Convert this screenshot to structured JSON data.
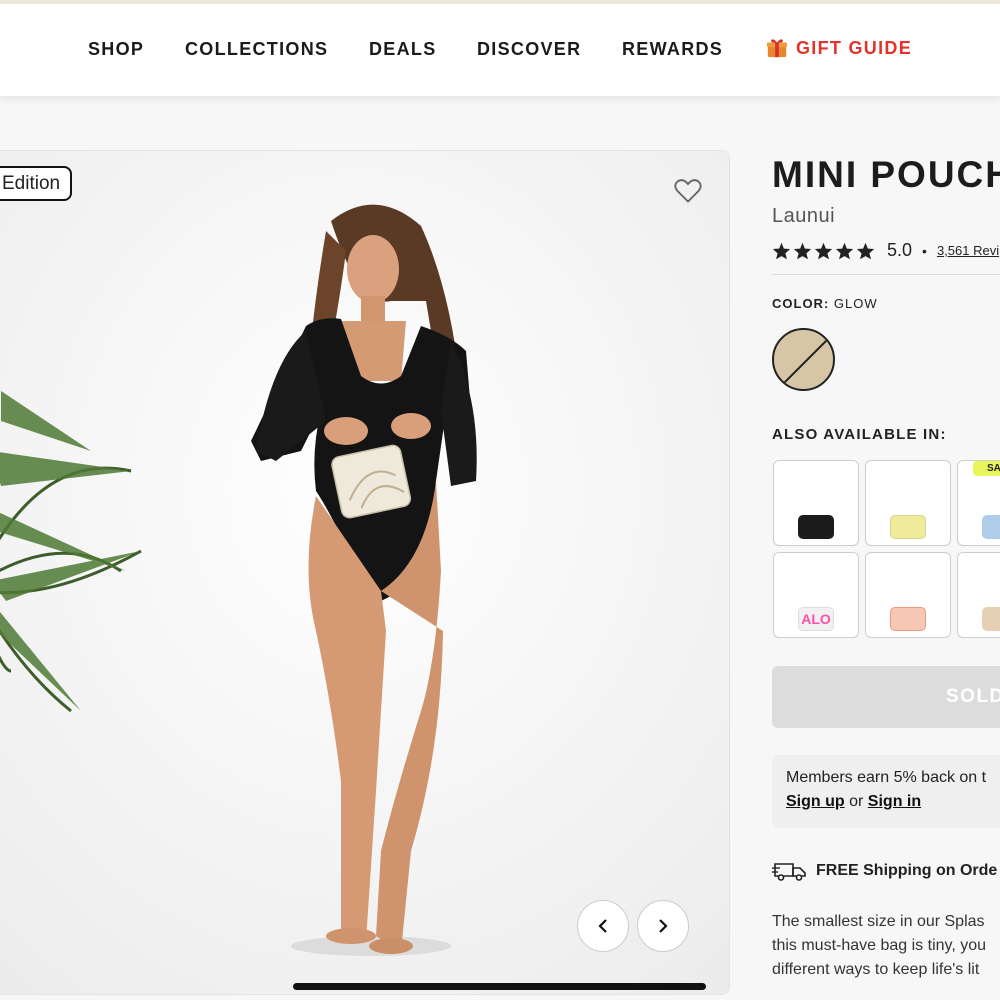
{
  "nav": {
    "items": [
      "SHOP",
      "COLLECTIONS",
      "DEALS",
      "DISCOVER",
      "REWARDS"
    ],
    "gift_guide": "GIFT GUIDE",
    "gift_color": "#e2342b"
  },
  "gallery": {
    "badge": "Edition",
    "favorite_icon": "heart-outline-icon",
    "prev_icon": "chevron-left-icon",
    "next_icon": "chevron-right-icon"
  },
  "product": {
    "title": "MINI POUCH",
    "subtitle": "Launui",
    "rating": "5.0",
    "stars": 5,
    "reviews": "3,561 Revi",
    "color_label": "COLOR:",
    "color_value": "GLOW",
    "swatch_color": "#d6c6a6"
  },
  "variants": {
    "label": "ALSO AVAILABLE IN:",
    "sale_badge": "SA",
    "items": [
      {
        "name": "black",
        "color": "#1c1c1c"
      },
      {
        "name": "yellow",
        "color": "#eeeb9a"
      },
      {
        "name": "blue-tie-dye",
        "color": "#aecdea"
      },
      {
        "name": "pink-alo",
        "color": "#f1f1f1",
        "text": "ALO"
      },
      {
        "name": "coral-print",
        "color": "#f6c8b4"
      },
      {
        "name": "tan",
        "color": "#e6d0b4"
      }
    ]
  },
  "cta": {
    "soldout": "SOLD"
  },
  "members": {
    "text": "Members earn 5% back on t",
    "signup": "Sign up",
    "or": "or",
    "signin": "Sign in"
  },
  "shipping": {
    "text": "FREE Shipping on Orde"
  },
  "description": [
    "The smallest size in our Splas",
    "this must-have bag is tiny, you",
    "different ways to keep life's lit"
  ]
}
